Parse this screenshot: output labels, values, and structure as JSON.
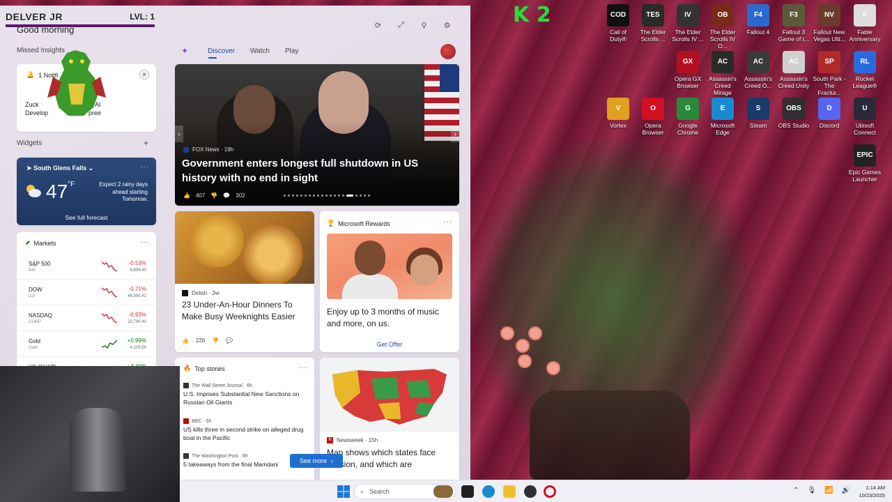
{
  "overlay": {
    "name": "DELVER JR",
    "level": "LVL: 1",
    "k_logo": "K 2"
  },
  "widgets": {
    "greeting": "Good morning",
    "missed_insights_label": "Missed Insights",
    "insight": {
      "title": "1 Notifi",
      "body_prefix": "Zuck",
      "body_middle": "s of AI",
      "body_line2_prefix": "Develop",
      "body_line2_suffix": "pree"
    },
    "widgets_label": "Widgets",
    "weather": {
      "location": "South Glens Falls",
      "temp": "47",
      "unit": "°F",
      "note": "Expect 2 rainy days ahead starting Tomorrow.",
      "link": "See full forecast"
    },
    "markets": {
      "title": "Markets",
      "rows": [
        {
          "name": "S&P 500",
          "sub": "INX",
          "change": "-0.53%",
          "value": "6,699.40",
          "color": "#d13438"
        },
        {
          "name": "DOW",
          "sub": "DJI",
          "change": "-0.71%",
          "value": "46,590.41",
          "color": "#d13438"
        },
        {
          "name": "NASDAQ",
          "sub": "COMP",
          "change": "-0.93%",
          "value": "22,740.40",
          "color": "#d13438"
        },
        {
          "name": "Gold",
          "sub": "Gold",
          "change": "+0.99%",
          "value": "4,105.50",
          "color": "#107c10"
        },
        {
          "name": "US Oil WTI",
          "sub": "",
          "change": "+3.40%",
          "value": "",
          "color": "#107c10"
        }
      ]
    }
  },
  "feed": {
    "tabs": [
      "Discover",
      "Watch",
      "Play"
    ],
    "hero": {
      "source": "FOX News · 19h",
      "title": "Government enters longest full shutdown in US history with no end in sight",
      "likes": "407",
      "comments": "302"
    },
    "food": {
      "source": "Delish · 2w",
      "title": "23 Under-An-Hour Dinners To Make Busy Weeknights Easier",
      "likes": "226"
    },
    "rewards": {
      "brand": "Microsoft Rewards",
      "title": "Enjoy up to 3 months of music and more, on us.",
      "cta": "Get Offer"
    },
    "top_stories": {
      "title": "Top stories",
      "items": [
        {
          "source": "The Wall Street Journal · 6h",
          "title": "U.S. Imposes Substantial New Sanctions on Russian Oil Giants"
        },
        {
          "source": "BBC · 5h",
          "title": "US kills three in second strike on alleged drug boat in the Pacific"
        },
        {
          "source": "The Washington Post · 6h",
          "title": "5 takeaways from the final Mamdani"
        }
      ],
      "see_more": "See more"
    },
    "map_story": {
      "source": "Newsweek · 15h",
      "title": "Map shows which states face session, and which are"
    }
  },
  "desktop_icons": [
    {
      "label": "Call of Duty®",
      "color": "#111111",
      "glyph": "COD"
    },
    {
      "label": "The Elder Scrolls ...",
      "color": "#2a2a2a",
      "glyph": "TES"
    },
    {
      "label": "The Elder Scrolls IV ...",
      "color": "#333333",
      "glyph": "IV"
    },
    {
      "label": "The Elder Scrolls IV O...",
      "color": "#7a2a1a",
      "glyph": "OB"
    },
    {
      "label": "Fallout 4",
      "color": "#2a6ad0",
      "glyph": "F4"
    },
    {
      "label": "Fallout 3 Game of t...",
      "color": "#5a5a3a",
      "glyph": "F3"
    },
    {
      "label": "Fallout New Vegas Ulti...",
      "color": "#6a3a2a",
      "glyph": "NV"
    },
    {
      "label": "Fable Anniversary",
      "color": "#dddddd",
      "glyph": "F"
    },
    {
      "label": "Opera GX Browser",
      "color": "#b01020",
      "glyph": "GX"
    },
    {
      "label": "Assassin's Creed Mirage",
      "color": "#2a2a2a",
      "glyph": "AC"
    },
    {
      "label": "Assassin's Creed O...",
      "color": "#3a3a3a",
      "glyph": "AC"
    },
    {
      "label": "Assassin's Creed Unity",
      "color": "#d0d0d0",
      "glyph": "AC"
    },
    {
      "label": "South Park - The Fractur...",
      "color": "#b02a2a",
      "glyph": "SP"
    },
    {
      "label": "Rocket League®",
      "color": "#2a6ae0",
      "glyph": "RL"
    },
    {
      "label": "Vortex",
      "color": "#e0a020",
      "glyph": "V"
    },
    {
      "label": "Opera Browser",
      "color": "#d01020",
      "glyph": "O"
    },
    {
      "label": "Google Chrome",
      "color": "#2a8a3a",
      "glyph": "G"
    },
    {
      "label": "Microsoft Edge",
      "color": "#1a8ad0",
      "glyph": "E"
    },
    {
      "label": "Steam",
      "color": "#1a3a6a",
      "glyph": "S"
    },
    {
      "label": "OBS Studio",
      "color": "#302e31",
      "glyph": "OBS"
    },
    {
      "label": "Discord",
      "color": "#5865f2",
      "glyph": "D"
    },
    {
      "label": "Ubisoft Connect",
      "color": "#2a2a3a",
      "glyph": "U"
    },
    {
      "label": "Epic Games Launcher",
      "color": "#222222",
      "glyph": "EPIC"
    }
  ],
  "taskbar": {
    "search_placeholder": "Search",
    "time": "1:14 AM",
    "date": "10/23/2025"
  },
  "colors": {
    "accent": "#1f4aa8",
    "negative": "#d13438",
    "positive": "#107c10"
  }
}
